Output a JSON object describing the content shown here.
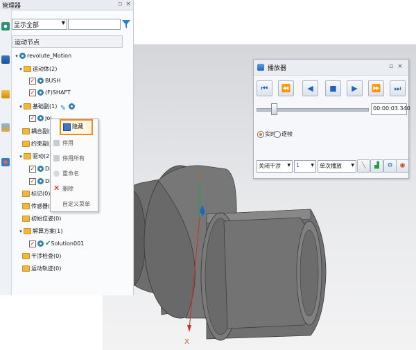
{
  "manager": {
    "title": "管理器",
    "filter_value": "显示全部",
    "search_value": "",
    "tree_header": "运动节点",
    "tree": {
      "root": "revolute_Motion",
      "bodies": "运动体(2)",
      "bush": "BUSH",
      "shaft": "(F)SHAFT",
      "base_pairs": "基础副(1)",
      "joint": "Join",
      "coupling_pairs": "耦合副(0)",
      "constraint_pairs": "约束副(0)",
      "drivers": "驱动(2)",
      "driver1": "Driv",
      "driver2": "Driv",
      "markers": "标记(0)",
      "sensors": "传感器(0)",
      "initial_positions": "初始位姿(0)",
      "solutions": "解算方案(1)",
      "solution": "Solution001",
      "interference": "干涉检查(0)",
      "trajectories": "运动轨迹(0)"
    }
  },
  "context_menu": {
    "items": [
      "隐藏",
      "停用",
      "停用所有",
      "重命名",
      "删除",
      "自定义菜单"
    ]
  },
  "player": {
    "title": "播放器",
    "time": "00:00:03.340",
    "slider_position": 0.16,
    "mode_realtime": "实时",
    "mode_frame": "逐帧",
    "interference_select": "关闭干涉",
    "step_select": "1",
    "play_mode_select": "单次播放"
  },
  "viewport": {
    "axis_z": "Z",
    "axis_x": "X"
  },
  "colors": {
    "accent_blue": "#1f63c8",
    "highlight_orange": "#f08a24",
    "part_gray": "#6a6a6a"
  }
}
